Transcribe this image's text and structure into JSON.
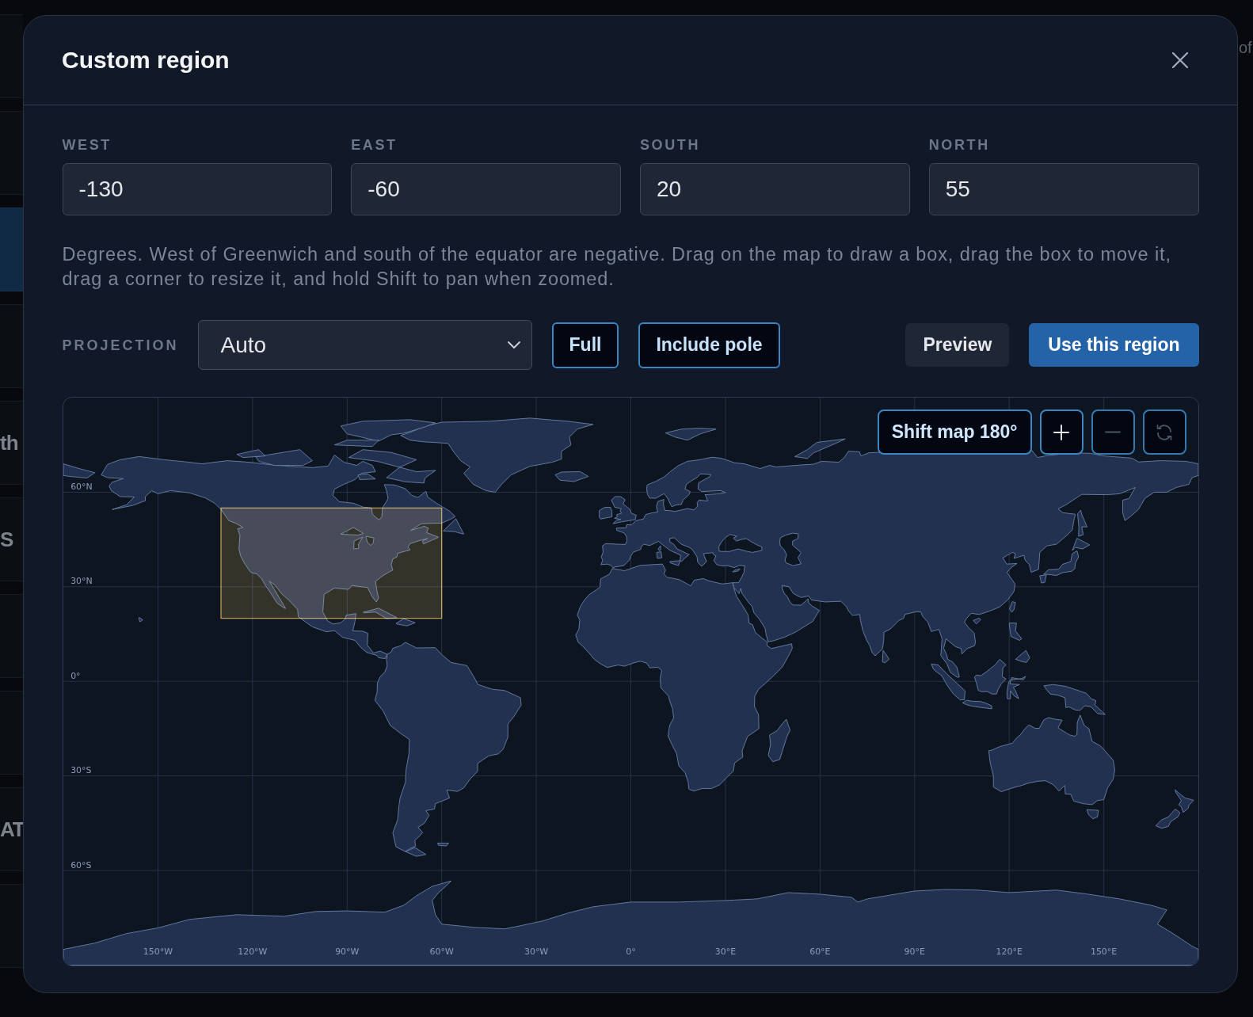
{
  "background_page": {
    "rows": [
      {
        "selected": false
      },
      {
        "selected": false
      },
      {
        "selected": true
      },
      {
        "selected": false
      },
      {
        "selected": false,
        "text": "th"
      },
      {
        "selected": false,
        "text": "S"
      },
      {
        "selected": false
      },
      {
        "selected": false
      },
      {
        "selected": false,
        "text": "AT"
      },
      {
        "selected": false
      }
    ],
    "corner_text": "of"
  },
  "dialog": {
    "title": "Custom region",
    "bounds": [
      {
        "label": "WEST",
        "value": "-130"
      },
      {
        "label": "EAST",
        "value": "-60"
      },
      {
        "label": "SOUTH",
        "value": "20"
      },
      {
        "label": "NORTH",
        "value": "55"
      }
    ],
    "help_text": "Degrees. West of Greenwich and south of the equator are negative. Drag on the map to draw a box, drag the box to move it, drag a corner to resize it, and hold Shift to pan when zoomed.",
    "projection": {
      "label": "PROJECTION",
      "value": "Auto"
    },
    "extent_buttons": [
      "Full",
      "Include pole"
    ],
    "actions": [
      {
        "label": "Preview",
        "kind": "secondary"
      },
      {
        "label": "Use this region",
        "kind": "primary"
      }
    ],
    "map": {
      "shift_button": "Shift map 180°",
      "zoom_controls": [
        {
          "kind": "zoom-in",
          "disabled": false
        },
        {
          "kind": "zoom-out",
          "disabled": true
        },
        {
          "kind": "reset",
          "disabled": true
        }
      ],
      "latitude_labels": [
        "60°N",
        "30°N",
        "0°",
        "30°S",
        "60°S"
      ],
      "longitude_labels": [
        "150°W",
        "120°W",
        "90°W",
        "60°W",
        "30°W",
        "0°",
        "30°E",
        "60°E",
        "90°E",
        "120°E",
        "150°E"
      ]
    }
  }
}
